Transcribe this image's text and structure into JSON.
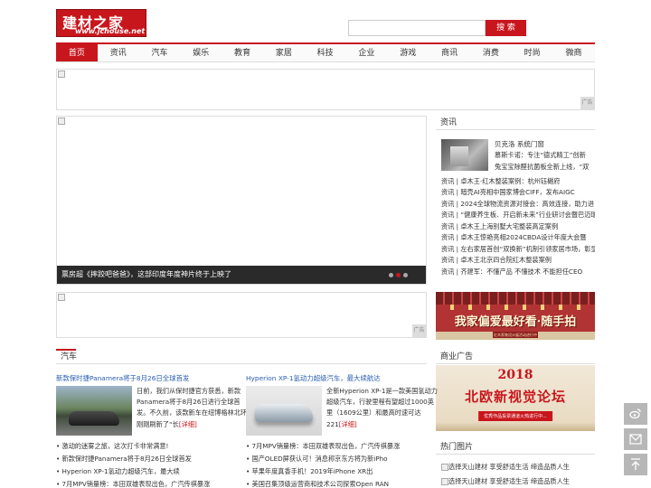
{
  "header": {
    "logo_cn": "建材之家",
    "logo_url": "www.jchouse.net",
    "search_placeholder": "",
    "search_button": "搜 索"
  },
  "nav": [
    "首页",
    "资讯",
    "汽车",
    "娱乐",
    "教育",
    "家居",
    "科技",
    "企业",
    "游戏",
    "商讯",
    "消费",
    "时尚",
    "微商"
  ],
  "ad_tag": "广告",
  "slide": {
    "caption": "票房超《摔跤吧爸爸》，这部印度年度神片终于上映了",
    "dots": 3,
    "active_dot": 1
  },
  "news": {
    "title": "资讯",
    "featured": [
      "贝克洛 系统门窗",
      "慕斯卡诺：专注“德式精工”创新",
      "兔宝宝除醛抗菌板全新上线，“双"
    ],
    "items": [
      "资讯 | 卓木王·红木整装案例：杭州钰樾府",
      "资讯 | 暗壳AI亮相中国家博会CIFF，发布AIGC",
      "资讯 | 2024全球物流资源对接会：高效连接，助力进",
      "资讯 | “健康养生板、开启新未来”行业研讨会暨巴迈瑞",
      "资讯 | 卓木王上海别墅大宅整装高定案例",
      "资讯 | 卓木王惊艳亮相2024CBDA设计年度大会暨",
      "资讯 | 左右家居首创“双换新”机制引领家居市场，彰显",
      "资讯 | 卓木王北京四合院红木整装案例",
      "资讯 | 齐建军：不懂产品 不懂技术 不能担任CEO"
    ]
  },
  "promo1": {
    "text": "我家偏爱最好看·随手拍",
    "sub": "红木家装设计展活动进行中"
  },
  "business_ad": {
    "title": "商业广告",
    "year": "2018",
    "headline": "北欧新视觉论坛",
    "button": "优秀作品投票通道火热进行中..."
  },
  "hot": {
    "title": "热门图片",
    "items": [
      "选择天山建材 享受舒适生活 缔造品质人生",
      "选择天山建材 享受舒适生活 缔造品质人生"
    ]
  },
  "auto": {
    "title": "汽车",
    "articles": [
      {
        "headline": "新款保时捷Panamera将于8月26日全球首发",
        "desc": [
          "日前，我们从保时捷官方获悉，新款",
          "Panamera将于8月26日进行全球首",
          "发。不久前，该款新车在纽博格林北环",
          "刚刚刷新了“长"
        ],
        "more": "[详细]",
        "list": [
          "激动的迷雾之旅，这次打卡非常满意!",
          "新款保时捷Panamera将于8月26日全球首发",
          "Hyperion XP-1氢动力超级汽车，最大续",
          "7月MPV销量榜：本田双雄表现出色，广汽传祺暴涨"
        ]
      },
      {
        "headline": "Hyperion XP-1氢动力超级汽车，最大续航达",
        "desc": [
          "全新Hyperion XP-1是一款美国氢动力",
          "超级汽车，行驶里程有望超过1000英",
          "里（1609公里）和最高时速可达",
          "221"
        ],
        "more": "[详细]",
        "list": [
          "7月MPV销量榜：本田双雄表现出色，广汽传祺暴涨",
          "国产OLED屏获认可！消息称京东方将为新iPho",
          "苹果年度真香手机！2019年iPhone XR出",
          "美国召集顶级运营商和技术公司探索Open RAN"
        ]
      }
    ]
  },
  "float_buttons": [
    "weibo-icon",
    "mail-icon",
    "back-to-top-icon"
  ]
}
